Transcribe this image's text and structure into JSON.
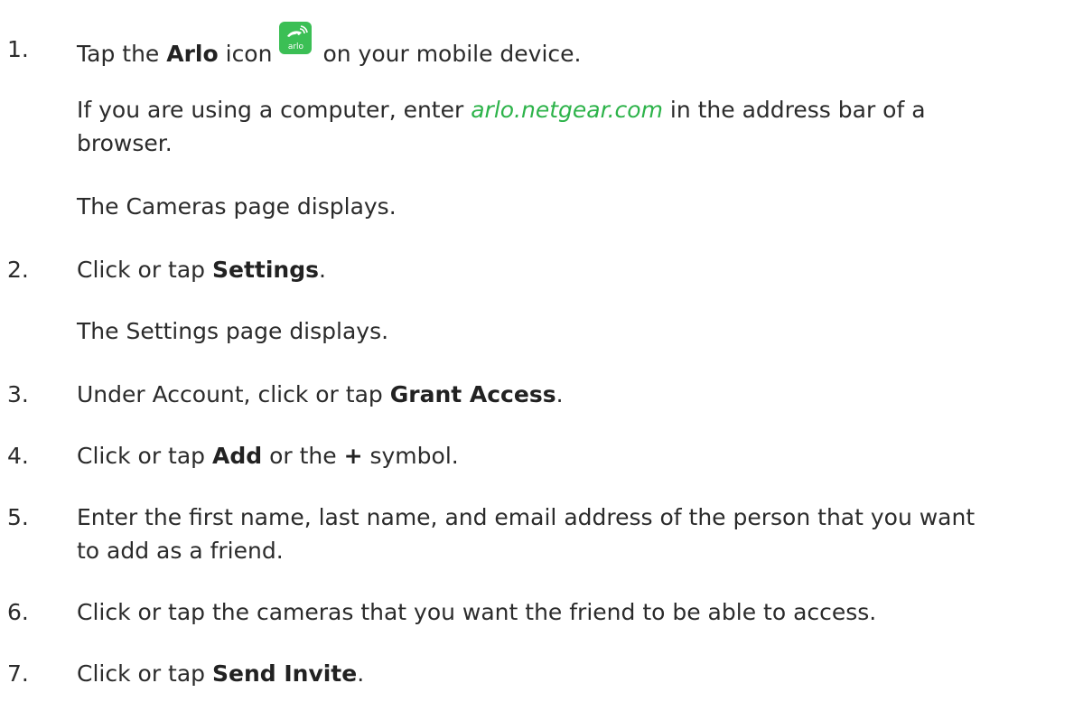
{
  "accent_color": "#2db34a",
  "steps": [
    {
      "number": "1.",
      "segments": [
        {
          "text": "Tap the ",
          "bold": false
        },
        {
          "text": "Arlo",
          "bold": true
        },
        {
          "text": " icon",
          "bold": false
        },
        {
          "icon": "arlo-app-icon",
          "icon_text": "arlo"
        },
        {
          "text": "on your mobile device.",
          "bold": false
        }
      ],
      "notes": [
        {
          "lines": [
            [
              {
                "text": "If you are using a computer, enter ",
                "style": "normal"
              },
              {
                "text": "arlo.netgear.com",
                "style": "link"
              },
              {
                "text": " in the address bar of a",
                "style": "normal"
              }
            ],
            [
              {
                "text": "browser.",
                "style": "normal"
              }
            ]
          ]
        },
        {
          "lines": [
            [
              {
                "text": "The Cameras page displays.",
                "style": "normal"
              }
            ]
          ]
        }
      ]
    },
    {
      "number": "2.",
      "segments": [
        {
          "text": "Click or tap ",
          "bold": false
        },
        {
          "text": "Settings",
          "bold": true
        },
        {
          "text": ".",
          "bold": false
        }
      ],
      "notes": [
        {
          "lines": [
            [
              {
                "text": "The Settings page displays.",
                "style": "normal"
              }
            ]
          ]
        }
      ]
    },
    {
      "number": "3.",
      "segments": [
        {
          "text": "Under Account, click or tap ",
          "bold": false
        },
        {
          "text": "Grant Access",
          "bold": true
        },
        {
          "text": ".",
          "bold": false
        }
      ]
    },
    {
      "number": "4.",
      "segments": [
        {
          "text": "Click or tap ",
          "bold": false
        },
        {
          "text": "Add",
          "bold": true
        },
        {
          "text": " or the ",
          "bold": false
        },
        {
          "text": "+",
          "bold": true
        },
        {
          "text": " symbol.",
          "bold": false
        }
      ]
    },
    {
      "number": "5.",
      "lines": [
        "Enter the first name, last name, and email address of the person that you want",
        "to add as a friend."
      ]
    },
    {
      "number": "6.",
      "segments": [
        {
          "text": "Click or tap the cameras that you want the friend to be able to access.",
          "bold": false
        }
      ]
    },
    {
      "number": "7.",
      "segments": [
        {
          "text": "Click or tap ",
          "bold": false
        },
        {
          "text": "Send Invite",
          "bold": true
        },
        {
          "text": ".",
          "bold": false
        }
      ]
    }
  ]
}
